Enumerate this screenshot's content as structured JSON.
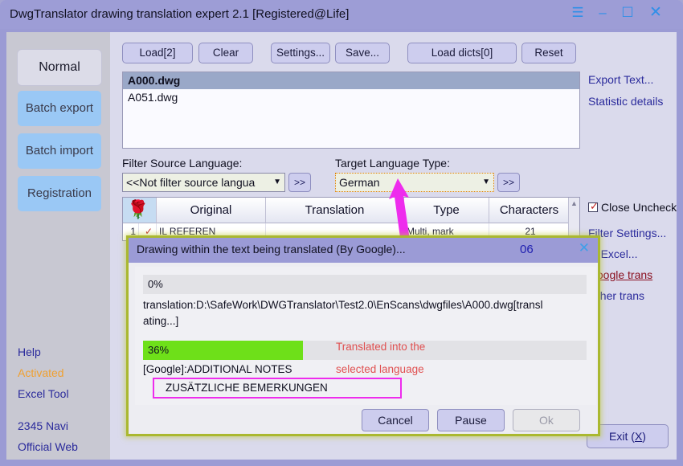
{
  "window": {
    "title": "DwgTranslator drawing translation expert 2.1 [Registered@Life]",
    "controls": {
      "menu": "☰",
      "minimize": "–",
      "maximize": "☐",
      "close": "✕"
    }
  },
  "sidebar": {
    "items": [
      {
        "label": "Normal",
        "state": "active"
      },
      {
        "label": "Batch export",
        "state": "normal"
      },
      {
        "label": "Batch import",
        "state": "normal"
      },
      {
        "label": "Registration",
        "state": "normal"
      }
    ],
    "links": [
      {
        "label": "Help",
        "color": "#2b2b9c"
      },
      {
        "label": "Activated",
        "color": "#f0a030"
      },
      {
        "label": "Excel Tool",
        "color": "#2b2b9c"
      },
      {
        "label": "2345 Navi",
        "color": "#2b2b9c"
      },
      {
        "label": "Official Web",
        "color": "#2b2b9c"
      }
    ]
  },
  "toolbar": {
    "buttons": [
      "Load[2]",
      "Clear",
      "Settings...",
      "Save...",
      "Load dicts[0]",
      "Reset"
    ]
  },
  "filelist": {
    "files": [
      {
        "name": "A000.dwg",
        "selected": true
      },
      {
        "name": "A051.dwg",
        "selected": false
      }
    ]
  },
  "right_links": {
    "export_text": "Export Text...",
    "statistic_details": "Statistic details",
    "close_uncheck": "Close Uncheck",
    "filter_settings": "Filter Settings...",
    "to_excel": "to Excel...",
    "google_trans": "Google trans",
    "other_trans": "Other trans"
  },
  "language": {
    "source_label": "Filter Source Language:",
    "source_value": "<<Not filter source langua",
    "target_label": "Target Language Type:",
    "target_value": "German",
    "go_button": ">>"
  },
  "table": {
    "headers": [
      "Original",
      "Translation",
      "Type",
      "Characters"
    ],
    "rose_icon": "🌹",
    "rows": [
      {
        "index": "1",
        "check": "✓",
        "original": "IL REFEREN",
        "translation": "",
        "type": "Multi, mark",
        "characters": "21"
      }
    ]
  },
  "exit": {
    "label": "Exit (",
    "accel": "X",
    "label_end": ")"
  },
  "dialog": {
    "title": "Drawing within the text being translated (By Google)...",
    "counter": "06",
    "close": "✕",
    "progress_top": {
      "percent": 0,
      "text": "0%"
    },
    "path_line1": "translation:D:\\SafeWork\\DWGTranslator\\Test2.0\\EnScans\\dwgfiles\\A000.dwg[transl",
    "path_line2": "ating...]",
    "progress_bottom": {
      "percent": 36,
      "text": "36%"
    },
    "source_note": "[Google]:ADDITIONAL NOTES",
    "translated_text": "ZUSÄTZLICHE BEMERKUNGEN",
    "annotation_line1": "Translated into the",
    "annotation_line2": "selected language",
    "buttons": [
      {
        "label": "Cancel",
        "enabled": true
      },
      {
        "label": "Pause",
        "enabled": true
      },
      {
        "label": "Ok",
        "enabled": false
      }
    ]
  },
  "colors": {
    "titlebar": "#9d9dd6",
    "accent_link": "#2b2b9c",
    "activated": "#f0a030",
    "progress_fill": "#6ee019",
    "annotation": "#e05050",
    "highlight_box": "#ee2ced",
    "dialog_glow": "#aab830",
    "arrow": "#ee2ced"
  }
}
